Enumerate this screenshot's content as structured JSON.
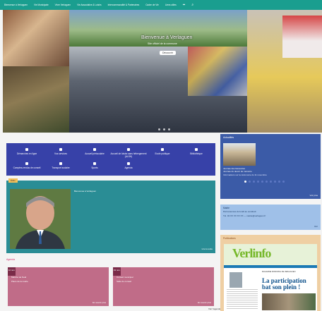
{
  "nav": {
    "items": [
      "Bienvenue à Verlaguen",
      "Vie Municipale",
      "Vivre Verlaguen",
      "Vie Associative & Loisirs",
      "Intercommunalité & Partenaires",
      "Cadre de Vie",
      "Liens utiles"
    ],
    "flag": "▪▪",
    "search": "⌕"
  },
  "hero": {
    "title": "Bienvenue à Verlaguen",
    "subtitle": "Site officiel de la commune",
    "button": "Découvrir"
  },
  "quicklinks": [
    "Démarches en ligne",
    "Vos services",
    "Accueil périscolaire",
    "Accueil de loisirs sans hébergement (ALSH)",
    "Ecole publique",
    "Bibliothèque",
    "Comptes-rendus de conseil",
    "Transport scolaire",
    "Sports",
    "Agenda"
  ],
  "actu": {
    "title": "Actualités",
    "caption": "Journée des bénévoles",
    "headline": "Journée du devoir de mémoire",
    "snippet": "Informations sur la cérémonie du 11 novembre",
    "more": "Voir plus"
  },
  "mayor": {
    "tag": "Édito",
    "name": "Bienvenue à Verlaguen",
    "more": "Lire la suite"
  },
  "contact": {
    "title": "Mairie",
    "line1": "Permanences du lundi au vendredi",
    "line2": "Tél. 04 XX XX XX XX — mairie@verlaguen.fr",
    "more": "Voir"
  },
  "agenda": {
    "title": "Agenda",
    "events": [
      {
        "date": "12\nnov.",
        "title": "Marché de Noël",
        "sub": "Place de la mairie"
      },
      {
        "date": "19\nnov.",
        "title": "Conseil municipal",
        "sub": "Salle du conseil"
      }
    ],
    "more_each": "En savoir plus",
    "all": "Voir l'agenda"
  },
  "publications": {
    "title": "Publications",
    "logo": "Verlinfo",
    "small": "MAGAZINE MUNICIPAL DE VERLAGUEN",
    "headline": "La participation bat son plein !"
  }
}
